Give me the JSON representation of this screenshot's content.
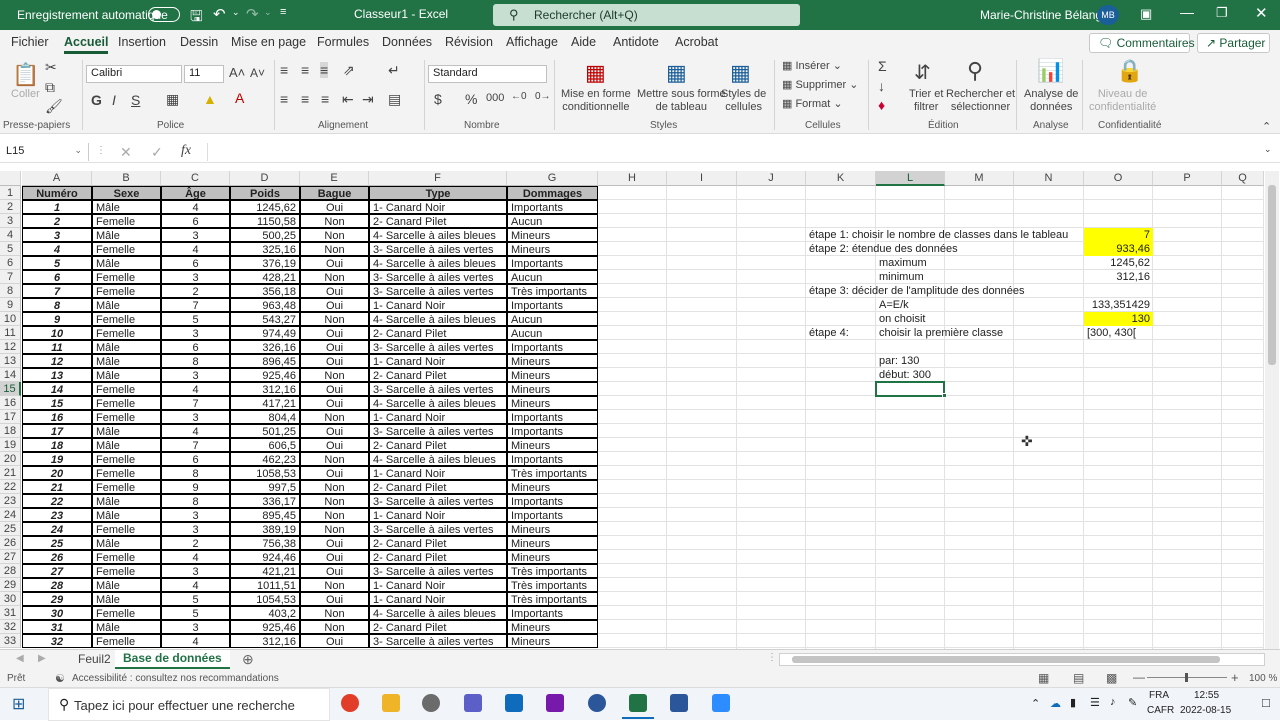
{
  "titlebar": {
    "autosave": "Enregistrement automatique",
    "doc_title": "Classeur1  -  Excel",
    "search_placeholder": "Rechercher (Alt+Q)",
    "user": "Marie-Christine Bélanger",
    "initials": "MB"
  },
  "menu": {
    "items": [
      "Fichier",
      "Accueil",
      "Insertion",
      "Dessin",
      "Mise en page",
      "Formules",
      "Données",
      "Révision",
      "Affichage",
      "Aide",
      "Antidote",
      "Acrobat"
    ],
    "comments": "Commentaires",
    "share": "Partager"
  },
  "ribbon": {
    "coller": "Coller",
    "font": "Calibri",
    "size": "11",
    "number_format": "Standard",
    "mfc": "Mise en forme\nconditionnelle",
    "mst": "Mettre sous forme\nde tableau",
    "styles": "Styles de\ncellules",
    "insert": "Insérer",
    "delete": "Supprimer",
    "format": "Format",
    "sort": "Trier et\nfiltrer",
    "find": "Rechercher et\nsélectionner",
    "analyse": "Analyse de\ndonnées",
    "conf": "Niveau de\nconfidentialité",
    "groups": [
      "Presse-papiers",
      "Police",
      "Alignement",
      "Nombre",
      "Styles",
      "Cellules",
      "Édition",
      "Analyse",
      "Confidentialité"
    ]
  },
  "namebox": "L15",
  "columns": [
    "A",
    "B",
    "C",
    "D",
    "E",
    "F",
    "G",
    "H",
    "I",
    "J",
    "K",
    "L",
    "M",
    "N",
    "O",
    "P",
    "Q"
  ],
  "headers": [
    "Numéro",
    "Sexe",
    "Âge",
    "Poids",
    "Bague",
    "Type",
    "Dommages"
  ],
  "rows": [
    [
      "1",
      "Mâle",
      "4",
      "1245,62",
      "Oui",
      "1- Canard Noir",
      "Importants"
    ],
    [
      "2",
      "Femelle",
      "6",
      "1150,58",
      "Non",
      "2- Canard Pilet",
      "Aucun"
    ],
    [
      "3",
      "Mâle",
      "3",
      "500,25",
      "Non",
      "4- Sarcelle à ailes bleues",
      "Mineurs"
    ],
    [
      "4",
      "Femelle",
      "4",
      "325,16",
      "Non",
      "3- Sarcelle à ailes vertes",
      "Mineurs"
    ],
    [
      "5",
      "Mâle",
      "6",
      "376,19",
      "Oui",
      "4- Sarcelle à ailes bleues",
      "Importants"
    ],
    [
      "6",
      "Femelle",
      "3",
      "428,21",
      "Non",
      "3- Sarcelle à ailes vertes",
      "Aucun"
    ],
    [
      "7",
      "Femelle",
      "2",
      "356,18",
      "Oui",
      "3- Sarcelle à ailes vertes",
      "Très importants"
    ],
    [
      "8",
      "Mâle",
      "7",
      "963,48",
      "Oui",
      "1- Canard Noir",
      "Importants"
    ],
    [
      "9",
      "Femelle",
      "5",
      "543,27",
      "Non",
      "4- Sarcelle à ailes bleues",
      "Aucun"
    ],
    [
      "10",
      "Femelle",
      "3",
      "974,49",
      "Oui",
      "2- Canard Pilet",
      "Aucun"
    ],
    [
      "11",
      "Mâle",
      "6",
      "326,16",
      "Oui",
      "3- Sarcelle à ailes vertes",
      "Importants"
    ],
    [
      "12",
      "Mâle",
      "8",
      "896,45",
      "Oui",
      "1- Canard Noir",
      "Mineurs"
    ],
    [
      "13",
      "Mâle",
      "3",
      "925,46",
      "Non",
      "2- Canard Pilet",
      "Mineurs"
    ],
    [
      "14",
      "Femelle",
      "4",
      "312,16",
      "Oui",
      "3- Sarcelle à ailes vertes",
      "Mineurs"
    ],
    [
      "15",
      "Femelle",
      "7",
      "417,21",
      "Oui",
      "4- Sarcelle à ailes bleues",
      "Mineurs"
    ],
    [
      "16",
      "Femelle",
      "3",
      "804,4",
      "Non",
      "1- Canard Noir",
      "Importants"
    ],
    [
      "17",
      "Mâle",
      "4",
      "501,25",
      "Oui",
      "3- Sarcelle à ailes vertes",
      "Importants"
    ],
    [
      "18",
      "Mâle",
      "7",
      "606,5",
      "Oui",
      "2- Canard Pilet",
      "Mineurs"
    ],
    [
      "19",
      "Femelle",
      "6",
      "462,23",
      "Non",
      "4- Sarcelle à ailes bleues",
      "Importants"
    ],
    [
      "20",
      "Femelle",
      "8",
      "1058,53",
      "Oui",
      "1- Canard Noir",
      "Très importants"
    ],
    [
      "21",
      "Femelle",
      "9",
      "997,5",
      "Non",
      "2- Canard Pilet",
      "Mineurs"
    ],
    [
      "22",
      "Mâle",
      "8",
      "336,17",
      "Non",
      "3- Sarcelle à ailes vertes",
      "Importants"
    ],
    [
      "23",
      "Mâle",
      "3",
      "895,45",
      "Non",
      "1- Canard Noir",
      "Importants"
    ],
    [
      "24",
      "Femelle",
      "3",
      "389,19",
      "Non",
      "3- Sarcelle à ailes vertes",
      "Mineurs"
    ],
    [
      "25",
      "Mâle",
      "2",
      "756,38",
      "Oui",
      "2- Canard Pilet",
      "Mineurs"
    ],
    [
      "26",
      "Femelle",
      "4",
      "924,46",
      "Oui",
      "2- Canard Pilet",
      "Mineurs"
    ],
    [
      "27",
      "Femelle",
      "3",
      "421,21",
      "Oui",
      "3- Sarcelle à ailes vertes",
      "Très importants"
    ],
    [
      "28",
      "Mâle",
      "4",
      "1011,51",
      "Non",
      "1- Canard Noir",
      "Très importants"
    ],
    [
      "29",
      "Mâle",
      "5",
      "1054,53",
      "Oui",
      "1- Canard Noir",
      "Très importants"
    ],
    [
      "30",
      "Femelle",
      "5",
      "403,2",
      "Non",
      "4- Sarcelle à ailes bleues",
      "Importants"
    ],
    [
      "31",
      "Mâle",
      "3",
      "925,46",
      "Non",
      "2- Canard Pilet",
      "Mineurs"
    ],
    [
      "32",
      "Femelle",
      "4",
      "312,16",
      "Oui",
      "3- Sarcelle à ailes vertes",
      "Mineurs"
    ]
  ],
  "side": {
    "r4_k": "étape 1: choisir le nombre de classes dans le tableau",
    "r4_o": "7",
    "r5_k": "étape 2: étendue des données",
    "r5_o": "933,46",
    "r6_l": "maximum",
    "r6_o": "1245,62",
    "r7_l": "minimum",
    "r7_o": "312,16",
    "r8_k": "étape 3: décider de l'amplitude des données",
    "r9_l": "A=E/k",
    "r9_o": "133,351429",
    "r10_l": "on choisit",
    "r10_o": "130",
    "r11_k": "étape 4:",
    "r11_l": "choisir la première classe",
    "r11_o": "[300, 430[",
    "r13_l": "par: 130",
    "r14_l": "début: 300"
  },
  "sheets": [
    "Feuil2",
    "Base de données"
  ],
  "status": {
    "ready": "Prêt",
    "accessibility": "Accessibilité : consultez nos recommandations",
    "zoom": "100 %"
  },
  "taskbar": {
    "search": "Tapez ici pour effectuer une recherche",
    "lang": "FRA",
    "region": "CAFR",
    "time": "12:55",
    "date": "2022-08-15"
  },
  "colors": {
    "excel_green": "#217346",
    "highlight": "#ffff00"
  }
}
